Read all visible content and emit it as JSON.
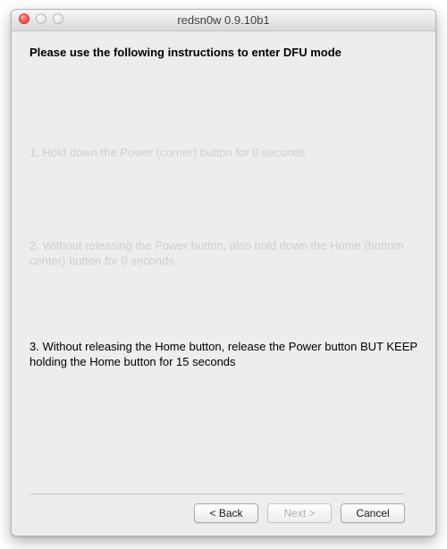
{
  "window": {
    "title": "redsn0w 0.9.10b1"
  },
  "content": {
    "heading": "Please use the following instructions to enter DFU mode",
    "step1": "1. Hold down the Power (corner) button for 0 seconds",
    "step2": "2. Without releasing the Power button, also hold down the Home (bottom center) button for 0 seconds",
    "step3": "3. Without releasing the Home button, release the Power button BUT KEEP holding the Home button for 15 seconds"
  },
  "buttons": {
    "back": "< Back",
    "next": "Next >",
    "cancel": "Cancel"
  }
}
